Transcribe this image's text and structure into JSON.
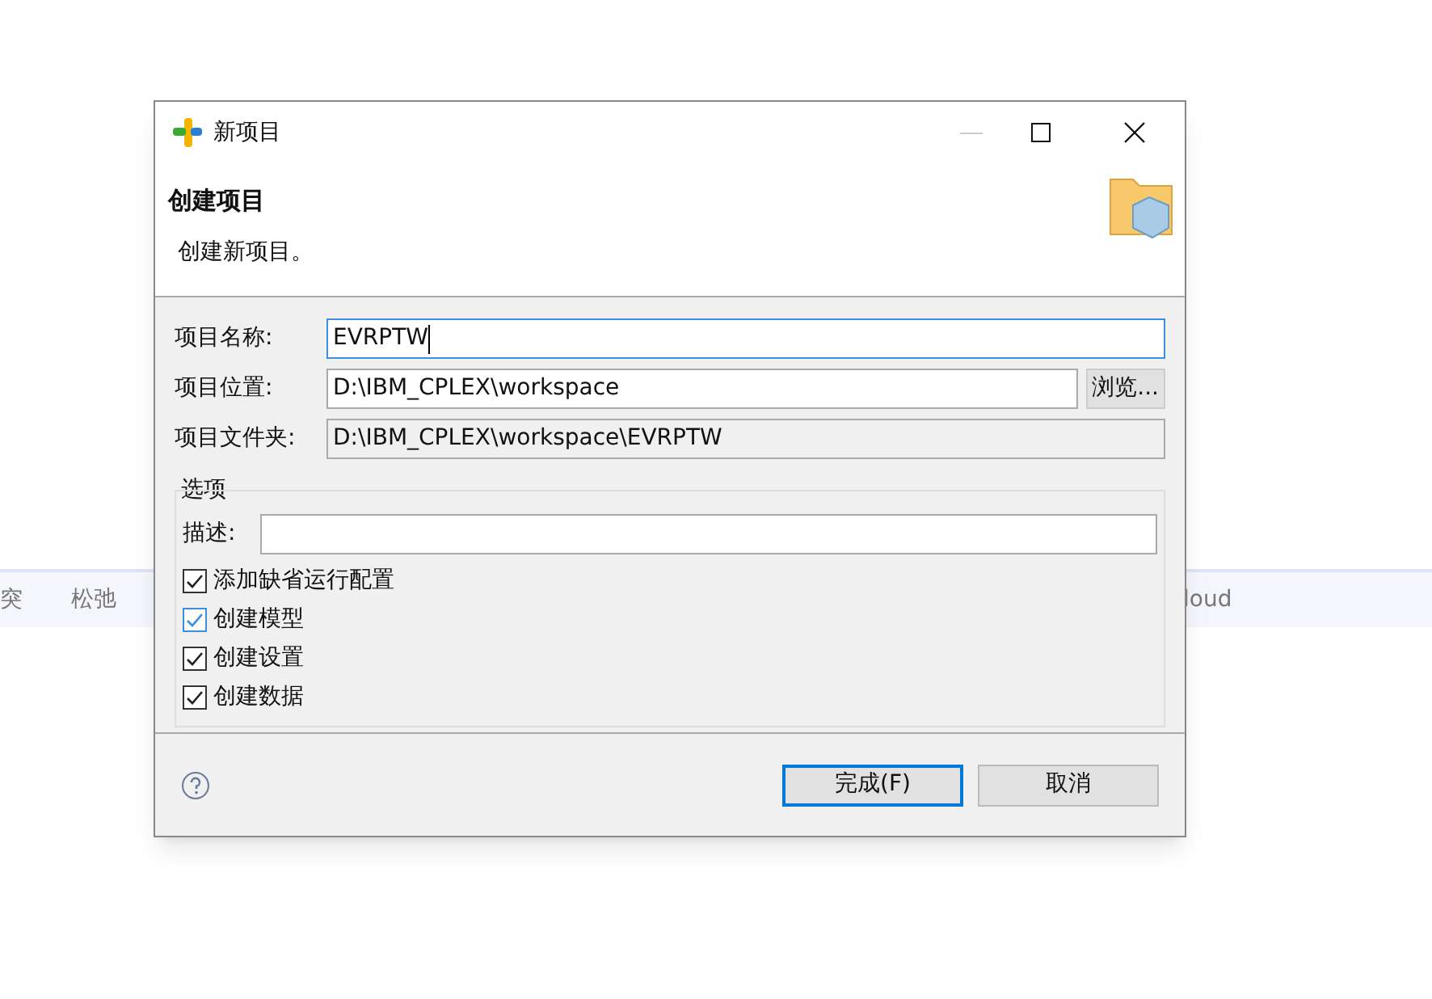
{
  "background_toolbar": {
    "items": [
      "突",
      "松弛",
      "loud"
    ]
  },
  "window": {
    "title": "新项目"
  },
  "header": {
    "title": "创建项目",
    "description": "创建新项目。"
  },
  "fields": [
    {
      "label": "项目名称:",
      "value": "EVRPTW",
      "focused": true,
      "disabled": false
    },
    {
      "label": "项目位置:",
      "value": "D:\\IBM_CPLEX\\workspace",
      "focused": false,
      "disabled": false,
      "button": "浏览..."
    },
    {
      "label": "项目文件夹:",
      "value": "D:\\IBM_CPLEX\\workspace\\EVRPTW",
      "focused": false,
      "disabled": true
    }
  ],
  "options": {
    "title": "选项",
    "description_label": "描述:",
    "checkboxes": [
      {
        "label": "添加缺省运行配置",
        "checked": true,
        "focused": false
      },
      {
        "label": "创建模型",
        "checked": true,
        "focused": true
      },
      {
        "label": "创建设置",
        "checked": true,
        "focused": false
      },
      {
        "label": "创建数据",
        "checked": true,
        "focused": false
      }
    ]
  },
  "buttons": [
    {
      "label": "完成(F)",
      "default": true
    },
    {
      "label": "取消",
      "default": false
    }
  ]
}
